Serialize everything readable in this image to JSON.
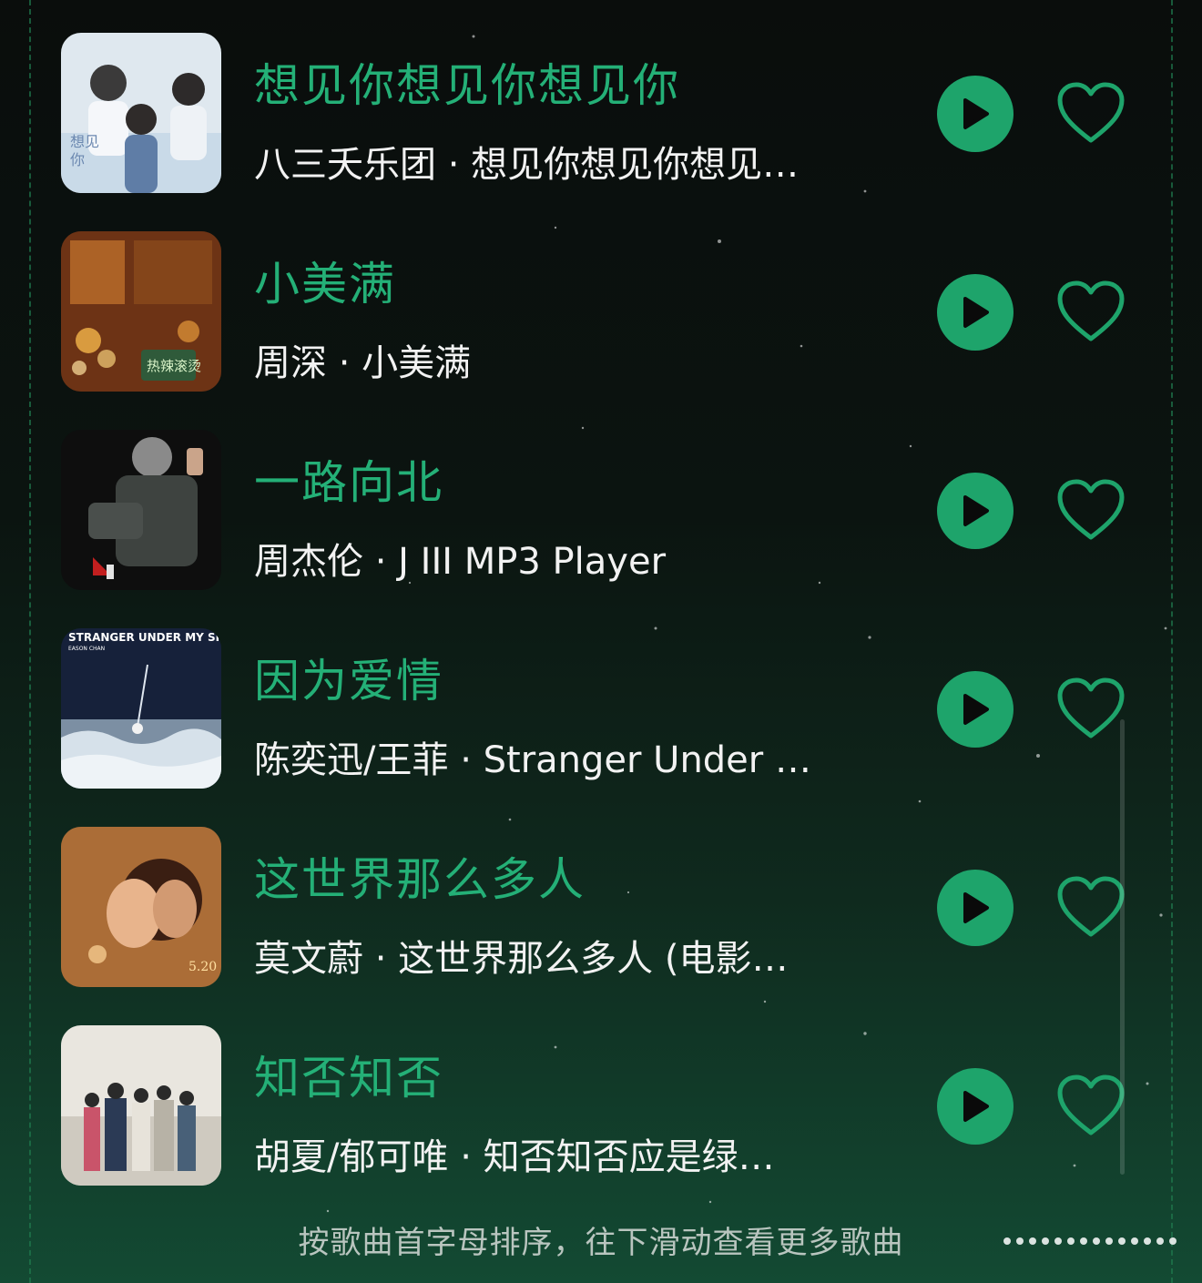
{
  "colors": {
    "accent": "#1ea46b",
    "title_green": "#24b077",
    "text_white": "#f2f2f2",
    "footer_gray": "#b9c5bf"
  },
  "songs": [
    {
      "title": "想见你想见你想见你",
      "subtitle": "八三夭乐团 · 想见你想见你想见…"
    },
    {
      "title": "小美满",
      "subtitle": "周深 · 小美满"
    },
    {
      "title": "一路向北",
      "subtitle": "周杰伦 · J III MP3 Player"
    },
    {
      "title": "因为爱情",
      "subtitle": "陈奕迅/王菲 · Stranger Under …",
      "cover_text": "STRANGER UNDER MY SKIN",
      "cover_subtext": "EASON CHAN"
    },
    {
      "title": "这世界那么多人",
      "subtitle": "莫文蔚 · 这世界那么多人 (电影…"
    },
    {
      "title": "知否知否",
      "subtitle": "胡夏/郁可唯 · 知否知否应是绿…"
    }
  ],
  "icons": {
    "play": "play-icon",
    "favorite": "heart-icon"
  },
  "footer": {
    "text": "按歌曲首字母排序，往下滑动查看更多歌曲"
  }
}
